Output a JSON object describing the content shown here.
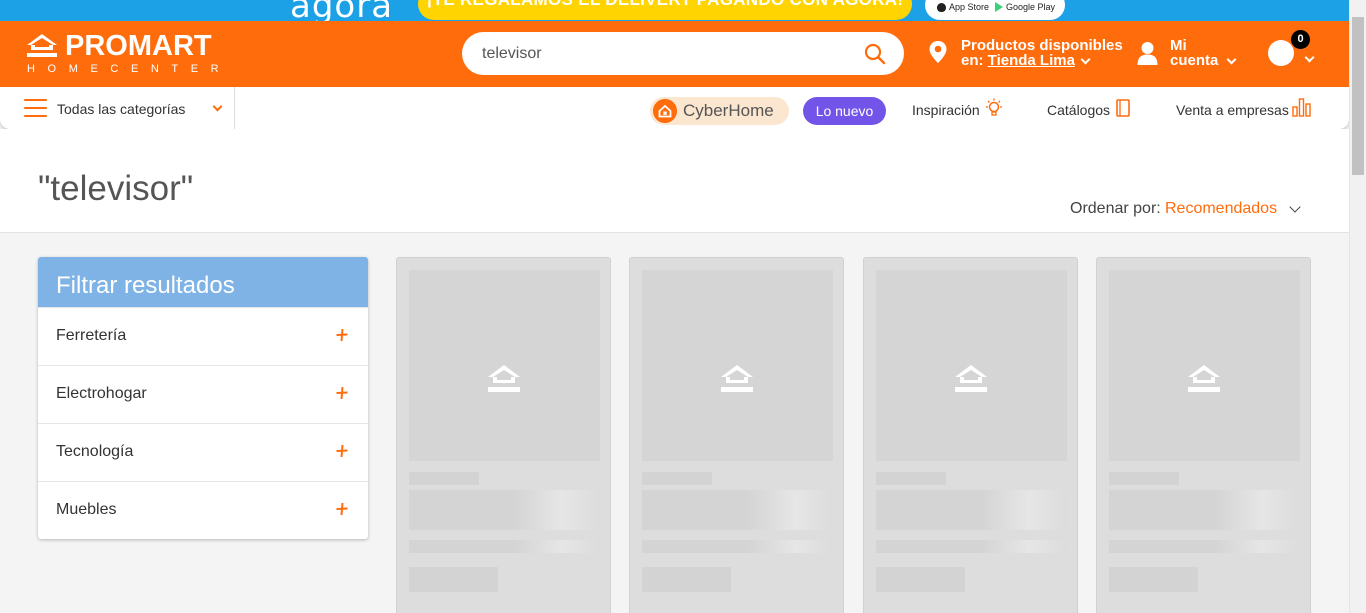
{
  "promo": {
    "brand": "agora",
    "message": "¡TE REGALAMOS EL DELIVERY PAGANDO CON AGORA!",
    "app_store": "App Store",
    "google_play": "Google Play"
  },
  "header": {
    "logo_main": "PROMART",
    "logo_sub": "HOMECENTER",
    "search_value": "televisor",
    "location_line1": "Productos disponibles",
    "location_prefix": "en: ",
    "location_store": "Tienda Lima",
    "account_line1": "Mi",
    "account_line2": "cuenta",
    "cart_count": "0"
  },
  "nav": {
    "categories_label": "Todas las categorías",
    "cyber_label": "CyberHome",
    "lo_nuevo": "Lo nuevo",
    "inspiracion": "Inspiración",
    "catalogos": "Catálogos",
    "venta_empresas": "Venta a empresas"
  },
  "results": {
    "query_title": "\"televisor\"",
    "sort_label": "Ordenar por:",
    "sort_value": "Recomendados"
  },
  "filters": {
    "title": "Filtrar resultados",
    "items": [
      {
        "label": "Ferretería"
      },
      {
        "label": "Electrohogar"
      },
      {
        "label": "Tecnología"
      },
      {
        "label": "Muebles"
      }
    ]
  },
  "colors": {
    "brand_orange": "#ff6c0c",
    "promo_blue": "#1da1e6",
    "filter_header_blue": "#7fb2e5",
    "lo_nuevo_purple": "#7254e9"
  }
}
